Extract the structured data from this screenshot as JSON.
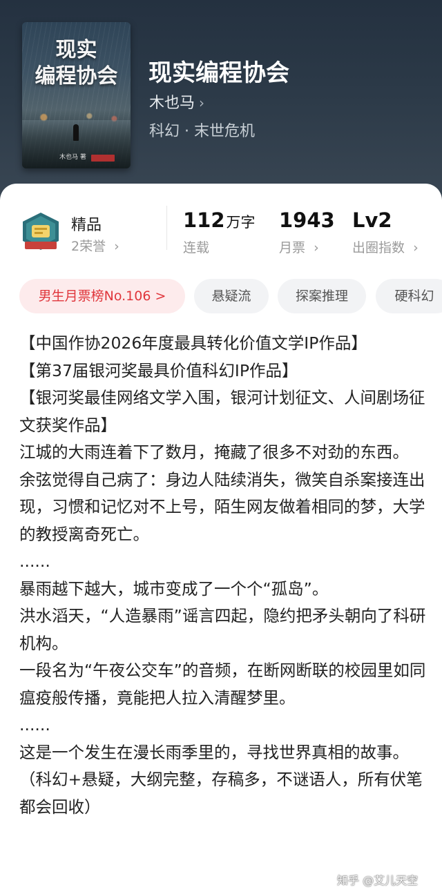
{
  "book": {
    "cover_title": "现实\n编程协会",
    "cover_author": "木也马 著",
    "title": "现实编程协会",
    "author": "木也马",
    "genre": "科幻 · 末世危机"
  },
  "stats": {
    "quality_label": "精品",
    "honors": "2荣誉",
    "word_count": "112",
    "word_unit": "万字",
    "status": "连载",
    "monthly_votes": "1943",
    "monthly_votes_label": "月票",
    "level": "Lv2",
    "level_label": "出圈指数"
  },
  "tags": [
    {
      "label": "男生月票榜No.106 >"
    },
    {
      "label": "悬疑流"
    },
    {
      "label": "探案推理"
    },
    {
      "label": "硬科幻"
    }
  ],
  "synopsis": [
    "【中国作协2026年度最具转化价值文学IP作品】",
    "【第37届银河奖最具价值科幻IP作品】",
    "【银河奖最佳网络文学入围，银河计划征文、人间剧场征文获奖作品】",
    "江城的大雨连着下了数月，掩藏了很多不对劲的东西。",
    "余弦觉得自己病了：身边人陆续消失，微笑自杀案接连出现，习惯和记忆对不上号，陌生网友做着相同的梦，大学的教授离奇死亡。",
    "......",
    "暴雨越下越大，城市变成了一个个“孤岛”。",
    "洪水滔天，“人造暴雨”谣言四起，隐约把矛头朝向了科研机构。",
    "一段名为“午夜公交车”的音频，在断网断联的校园里如同瘟疫般传播，竟能把人拉入清醒梦里。",
    "......",
    "这是一个发生在漫长雨季里的，寻找世界真相的故事。",
    "（科幻+悬疑，大纲完整，存稿多，不谜语人，所有伏笔都会回收）"
  ],
  "watermark": "知乎 @艾儿天空",
  "colors": {
    "header_bg": "#2c3a48",
    "rank_tag_bg": "#fdebec",
    "rank_tag_text": "#e0353b",
    "tag_bg": "#f2f3f5"
  }
}
